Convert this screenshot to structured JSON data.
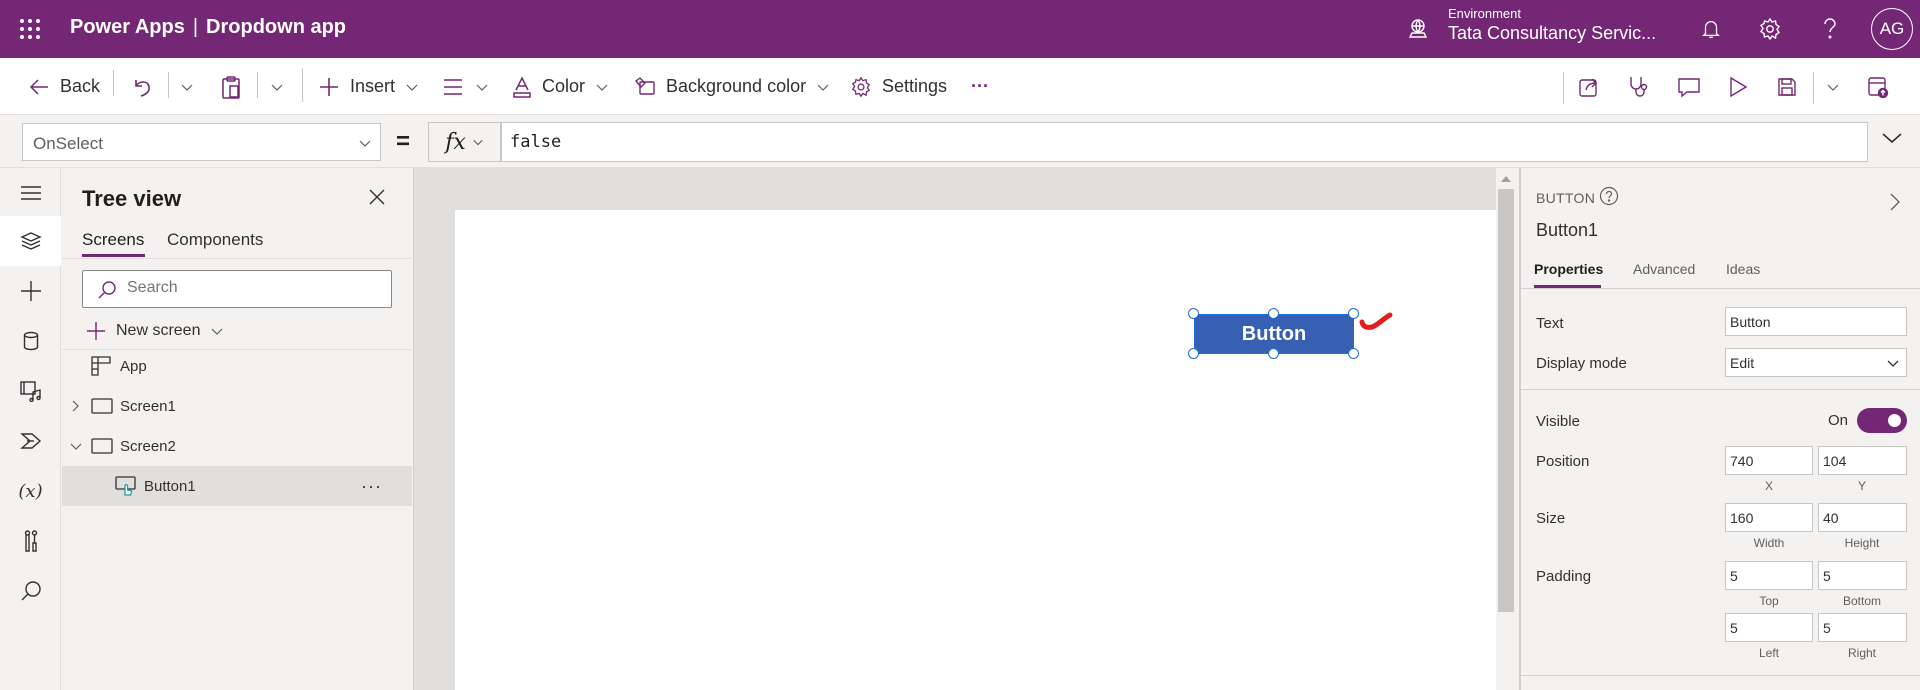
{
  "header": {
    "product": "Power Apps",
    "separator": "|",
    "app_name": "Dropdown app",
    "environment_label": "Environment",
    "environment_name": "Tata Consultancy Servic...",
    "avatar_initials": "AG",
    "icons": [
      "waffle-icon",
      "environment-icon",
      "bell-icon",
      "gear-icon",
      "help-icon"
    ]
  },
  "toolbar": {
    "back": "Back",
    "insert": "Insert",
    "color": "Color",
    "background_color": "Background color",
    "settings": "Settings",
    "more": "···",
    "right_icons": [
      "share-icon",
      "app-checker-icon",
      "comments-icon",
      "preview-play-icon",
      "save-icon",
      "save-options-chevron-icon",
      "publish-icon"
    ]
  },
  "formula_bar": {
    "property": "OnSelect",
    "equals": "=",
    "fx": "fx",
    "formula": "false"
  },
  "left_rail": {
    "items": [
      "menu-icon",
      "tree-view-icon",
      "insert-icon",
      "data-icon",
      "media-icon",
      "power-automate-icon",
      "variables-icon",
      "advanced-tools-icon",
      "search-icon"
    ],
    "active": "tree-view-icon"
  },
  "tree_view": {
    "title": "Tree view",
    "tabs": [
      {
        "label": "Screens",
        "active": true
      },
      {
        "label": "Components",
        "active": false
      }
    ],
    "search_placeholder": "Search",
    "new_screen": "New screen",
    "items": [
      {
        "label": "App",
        "type": "app",
        "level": 0
      },
      {
        "label": "Screen1",
        "type": "screen",
        "level": 0,
        "expanded": false
      },
      {
        "label": "Screen2",
        "type": "screen",
        "level": 0,
        "expanded": true
      },
      {
        "label": "Button1",
        "type": "button",
        "level": 1,
        "selected": true
      }
    ],
    "more": "···"
  },
  "canvas": {
    "button_text": "Button",
    "annotation_color": "#e01e1e"
  },
  "properties": {
    "control_type": "BUTTON",
    "control_name": "Button1",
    "tabs": [
      {
        "label": "Properties",
        "active": true
      },
      {
        "label": "Advanced",
        "active": false
      },
      {
        "label": "Ideas",
        "active": false
      }
    ],
    "text_label": "Text",
    "text_value": "Button",
    "display_mode_label": "Display mode",
    "display_mode_value": "Edit",
    "visible_label": "Visible",
    "visible_state": "On",
    "visible_on": true,
    "position_label": "Position",
    "position_x": "740",
    "position_y": "104",
    "x_label": "X",
    "y_label": "Y",
    "size_label": "Size",
    "width": "160",
    "height": "40",
    "width_label": "Width",
    "height_label": "Height",
    "padding_label": "Padding",
    "padding_top": "5",
    "padding_bottom": "5",
    "padding_left": "5",
    "padding_right": "5",
    "top_label": "Top",
    "bottom_label": "Bottom",
    "left_label": "Left",
    "right_label": "Right"
  },
  "colors": {
    "brand": "#742774",
    "button_fill": "#3860b2",
    "selection": "#1e6fd9"
  }
}
